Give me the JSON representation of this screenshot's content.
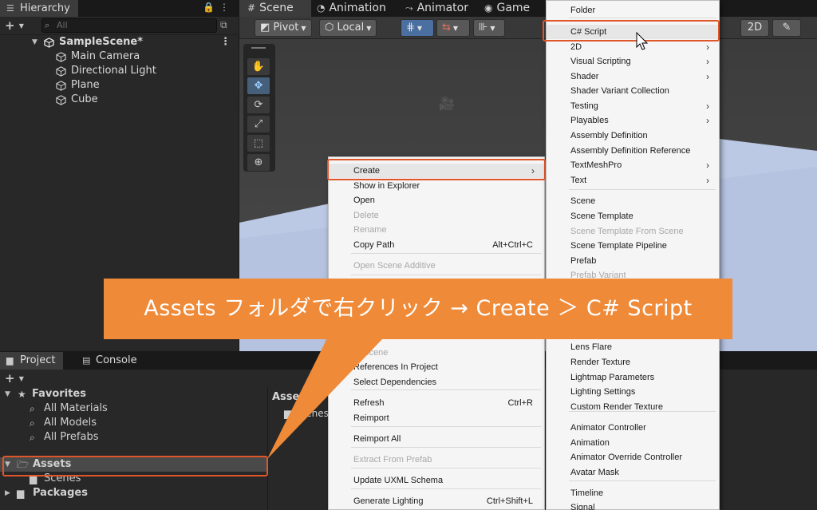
{
  "hierarchy": {
    "tab": "Hierarchy",
    "search_placeholder": "All",
    "scene": "SampleScene*",
    "objects": [
      "Main Camera",
      "Directional Light",
      "Plane",
      "Cube"
    ]
  },
  "scene_view": {
    "tabs": [
      "Scene",
      "Animation",
      "Animator",
      "Game"
    ],
    "pivot": "Pivot",
    "local": "Local",
    "mode_2d": "2D"
  },
  "project": {
    "tabs": [
      "Project",
      "Console"
    ],
    "favorites": {
      "label": "Favorites",
      "items": [
        "All Materials",
        "All Models",
        "All Prefabs"
      ]
    },
    "assets": "Assets",
    "scenes": "Scenes",
    "packages": "Packages",
    "breadcrumb": "Assets",
    "right_items": [
      "Scenes"
    ]
  },
  "context_menu": {
    "items": [
      {
        "label": "Create",
        "submenu": true
      },
      {
        "label": "Show in Explorer"
      },
      {
        "label": "Open"
      },
      {
        "label": "Delete",
        "disabled": true
      },
      {
        "label": "Rename",
        "disabled": true
      },
      {
        "label": "Copy Path",
        "shortcut": "Alt+Ctrl+C"
      },
      {
        "label": "Open Scene Additive",
        "disabled": true
      },
      {
        "label": "In Scene",
        "disabled": true
      },
      {
        "label": "References In Project"
      },
      {
        "label": "Select Dependencies"
      },
      {
        "label": "Refresh",
        "shortcut": "Ctrl+R"
      },
      {
        "label": "Reimport"
      },
      {
        "label": "Reimport All"
      },
      {
        "label": "Extract From Prefab",
        "disabled": true
      },
      {
        "label": "Update UXML Schema"
      },
      {
        "label": "Generate Lighting",
        "shortcut": "Ctrl+Shift+L"
      }
    ]
  },
  "create_menu": {
    "items": [
      {
        "label": "Folder"
      },
      {
        "label": "C# Script",
        "highlight": true
      },
      {
        "label": "2D",
        "submenu": true
      },
      {
        "label": "Visual Scripting",
        "submenu": true
      },
      {
        "label": "Shader",
        "submenu": true
      },
      {
        "label": "Shader Variant Collection"
      },
      {
        "label": "Testing",
        "submenu": true
      },
      {
        "label": "Playables",
        "submenu": true
      },
      {
        "label": "Assembly Definition"
      },
      {
        "label": "Assembly Definition Reference"
      },
      {
        "label": "TextMeshPro",
        "submenu": true
      },
      {
        "label": "Text",
        "submenu": true
      },
      {
        "label": "Scene"
      },
      {
        "label": "Scene Template"
      },
      {
        "label": "Scene Template From Scene",
        "disabled": true
      },
      {
        "label": "Scene Template Pipeline"
      },
      {
        "label": "Prefab"
      },
      {
        "label": "Prefab Variant",
        "disabled": true
      },
      {
        "label": "Lens Flare"
      },
      {
        "label": "Render Texture"
      },
      {
        "label": "Lightmap Parameters"
      },
      {
        "label": "Lighting Settings"
      },
      {
        "label": "Custom Render Texture"
      },
      {
        "label": "Animator Controller"
      },
      {
        "label": "Animation"
      },
      {
        "label": "Animator Override Controller"
      },
      {
        "label": "Avatar Mask"
      },
      {
        "label": "Timeline"
      },
      {
        "label": "Signal"
      }
    ]
  },
  "callout": "Assets フォルダで右クリック → Create ＞ C#  Script",
  "colors": {
    "highlight_box": "#e0562b",
    "callout_bg": "#ef8a38",
    "plane": "#b5c2e0"
  }
}
